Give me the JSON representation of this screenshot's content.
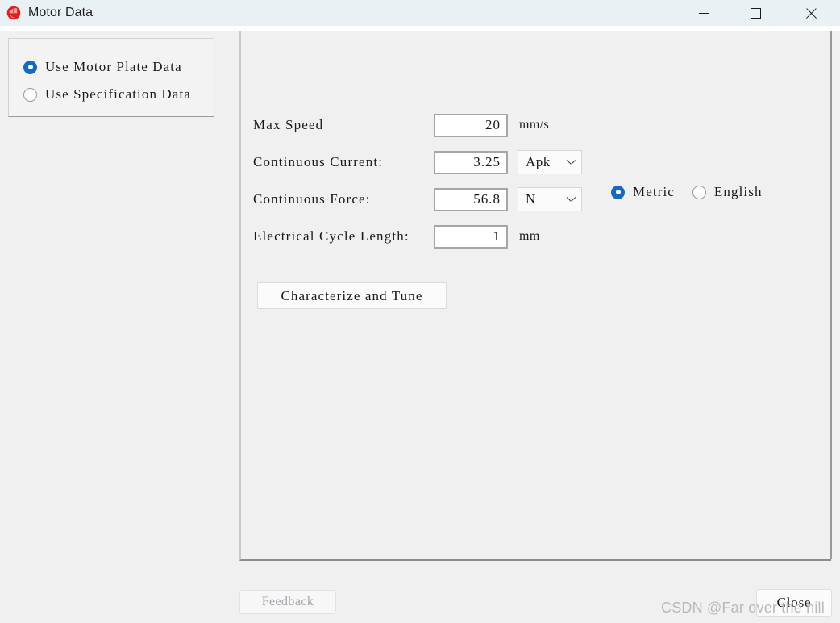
{
  "window": {
    "title": "Motor Data",
    "icon": "motor-app-icon",
    "controls": {
      "minimize": "minimize-icon",
      "maximize": "maximize-icon",
      "close": "close-icon"
    }
  },
  "data_source_group": {
    "options": [
      {
        "label": "Use Motor Plate Data",
        "selected": true
      },
      {
        "label": "Use Specification Data",
        "selected": false
      }
    ]
  },
  "form": {
    "rows": [
      {
        "label": "Max Speed",
        "value": "20",
        "unit": "mm/s",
        "select": null
      },
      {
        "label": "Continuous Current:",
        "value": "3.25",
        "unit": null,
        "select": "Apk"
      },
      {
        "label": "Continuous Force:",
        "value": "56.8",
        "unit": null,
        "select": "N"
      },
      {
        "label": "Electrical Cycle Length:",
        "value": "1",
        "unit": "mm",
        "select": null
      }
    ]
  },
  "unit_system": {
    "options": [
      {
        "label": "Metric",
        "selected": true
      },
      {
        "label": "English",
        "selected": false
      }
    ]
  },
  "actions": {
    "characterize_label": "Characterize and Tune",
    "feedback_label": "Feedback",
    "close_label": "Close"
  },
  "watermark": "CSDN @Far over the hill",
  "colors": {
    "titlebar": "#eaf1f5",
    "body": "#f0f0f0",
    "accent_radio": "#1668c1",
    "input_border": "#a6a6a6",
    "disabled_text": "#a8a2ab"
  }
}
